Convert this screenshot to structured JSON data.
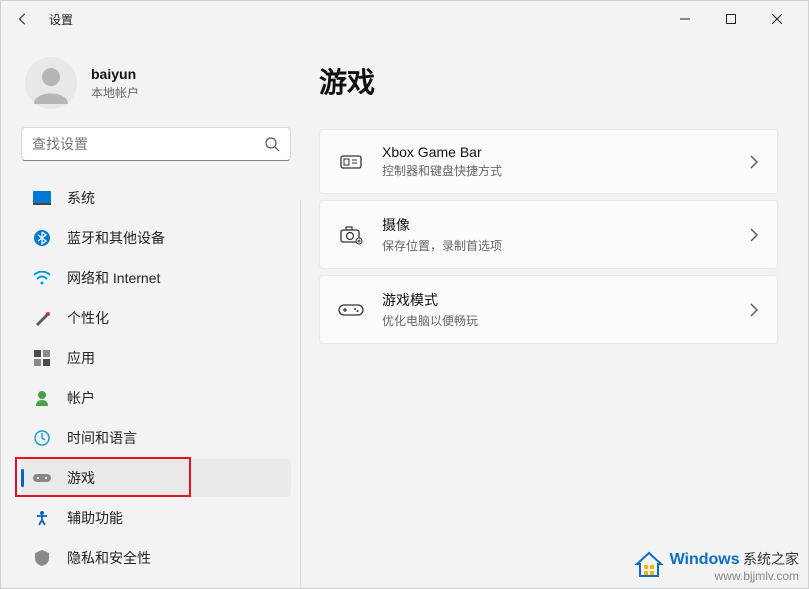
{
  "titlebar": {
    "title": "设置"
  },
  "profile": {
    "username": "baiyun",
    "subtitle": "本地帐户"
  },
  "search": {
    "placeholder": "查找设置"
  },
  "sidebar": {
    "items": [
      {
        "label": "系统"
      },
      {
        "label": "蓝牙和其他设备"
      },
      {
        "label": "网络和 Internet"
      },
      {
        "label": "个性化"
      },
      {
        "label": "应用"
      },
      {
        "label": "帐户"
      },
      {
        "label": "时间和语言"
      },
      {
        "label": "游戏"
      },
      {
        "label": "辅助功能"
      },
      {
        "label": "隐私和安全性"
      }
    ]
  },
  "main": {
    "title": "游戏",
    "cards": [
      {
        "title": "Xbox Game Bar",
        "sub": "控制器和键盘快捷方式"
      },
      {
        "title": "摄像",
        "sub": "保存位置，录制首选项"
      },
      {
        "title": "游戏模式",
        "sub": "优化电脑以便畅玩"
      }
    ]
  },
  "watermark": {
    "brand": "Windows",
    "cn": "系统之家",
    "url": "www.bjjmlv.com"
  }
}
